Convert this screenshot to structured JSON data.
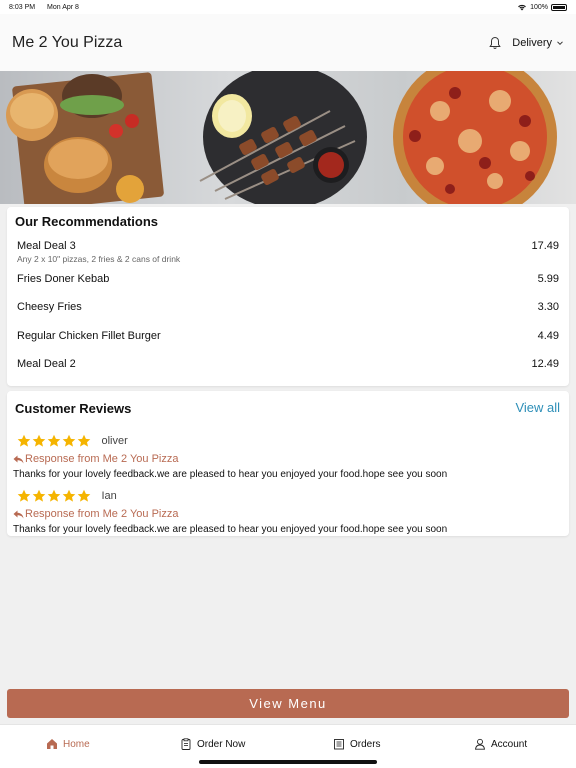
{
  "status_bar": {
    "time": "8:03 PM",
    "date": "Mon Apr 8",
    "battery": "100%"
  },
  "header": {
    "title": "Me 2 You Pizza",
    "delivery_label": "Delivery"
  },
  "recommendations": {
    "title": "Our Recommendations",
    "items": [
      {
        "name": "Meal Deal 3",
        "description": "Any 2 x 10\" pizzas, 2 fries & 2 cans of drink",
        "price": "17.49"
      },
      {
        "name": "Fries Doner Kebab",
        "price": "5.99"
      },
      {
        "name": "Cheesy Fries",
        "price": "3.30"
      },
      {
        "name": "Regular Chicken Fillet Burger",
        "price": "4.49"
      },
      {
        "name": "Meal Deal 2",
        "price": "12.49"
      }
    ]
  },
  "reviews": {
    "title": "Customer Reviews",
    "view_all_label": "View all",
    "items": [
      {
        "reviewer": "oliver",
        "rating": 5,
        "response_label": "Response from Me 2 You Pizza",
        "response_text": "Thanks for your lovely feedback.we are pleased to hear you enjoyed your food.hope see you soon"
      },
      {
        "reviewer": "Ian",
        "rating": 5,
        "response_label": "Response from Me 2 You Pizza",
        "response_text": "Thanks for your lovely feedback.we are pleased to hear you enjoyed your food.hope see you soon"
      }
    ]
  },
  "view_menu_label": "View Menu",
  "tabs": [
    {
      "label": "Home",
      "icon": "home-icon",
      "active": true
    },
    {
      "label": "Order Now",
      "icon": "clipboard-icon",
      "active": false
    },
    {
      "label": "Orders",
      "icon": "receipt-icon",
      "active": false
    },
    {
      "label": "Account",
      "icon": "person-icon",
      "active": false
    }
  ],
  "colors": {
    "accent": "#b86a52",
    "link": "#2e8fb8",
    "star": "#f5b400"
  }
}
